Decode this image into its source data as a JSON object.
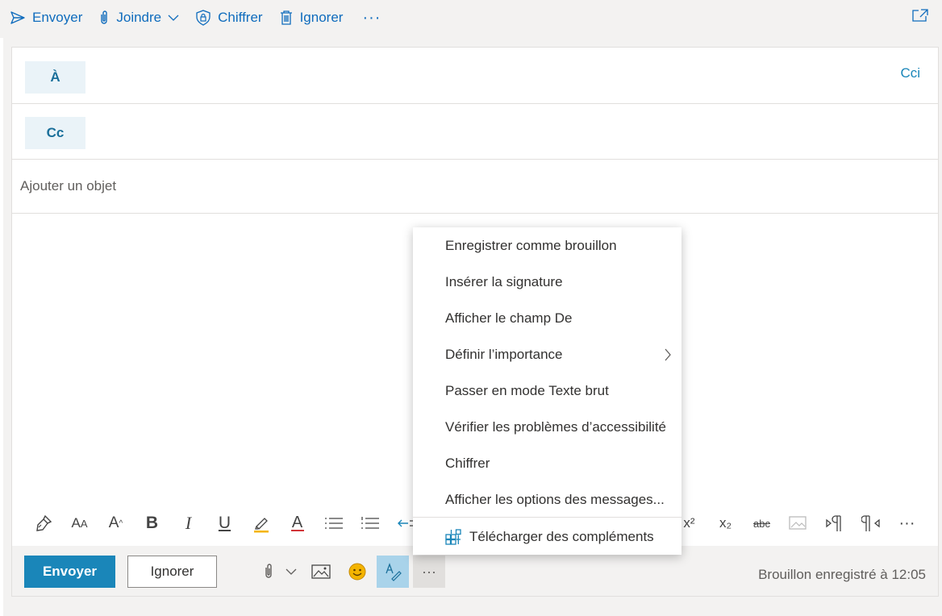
{
  "toolbar": {
    "send_label": "Envoyer",
    "attach_label": "Joindre",
    "encrypt_label": "Chiffrer",
    "discard_label": "Ignorer",
    "more_label": "···"
  },
  "recipients": {
    "to_label": "À",
    "cc_label": "Cc",
    "bcc_label": "Cci"
  },
  "subject": {
    "placeholder": "Ajouter un objet"
  },
  "context_menu": {
    "items": [
      "Enregistrer comme brouillon",
      "Insérer la signature",
      "Afficher le champ De",
      "Définir l’importance",
      "Passer en mode Texte brut",
      "Vérifier les problèmes d’accessibilité",
      "Chiffrer",
      "Afficher les options des messages..."
    ],
    "addins_label": "Télécharger des compléments"
  },
  "format_bar": {
    "icons": [
      "format-painter-icon",
      "font-size-icon",
      "grow-font-icon",
      "bold-icon",
      "italic-icon",
      "underline-icon",
      "highlight-icon",
      "font-color-icon",
      "bullets-icon",
      "numbering-icon",
      "decrease-indent-icon",
      "superscript-icon",
      "subscript-icon",
      "strikethrough-icon",
      "insert-picture-icon",
      "ltr-icon",
      "rtl-icon",
      "more-options-icon"
    ],
    "bold": "B",
    "italic": "I",
    "underline": "U",
    "font_color": "A",
    "superscript": "x²",
    "subscript": "x₂",
    "strikethrough": "abc",
    "more": "···"
  },
  "bottom": {
    "send_label": "Envoyer",
    "discard_label": "Ignorer",
    "more_label": "···",
    "saved_status": "Brouillon enregistré à 12:05"
  },
  "colors": {
    "accent": "#1a86b9",
    "toolbar_text": "#0f6cbd",
    "recipient_bg": "#eaf3f8",
    "highlight_active": "#a9d3ea"
  }
}
